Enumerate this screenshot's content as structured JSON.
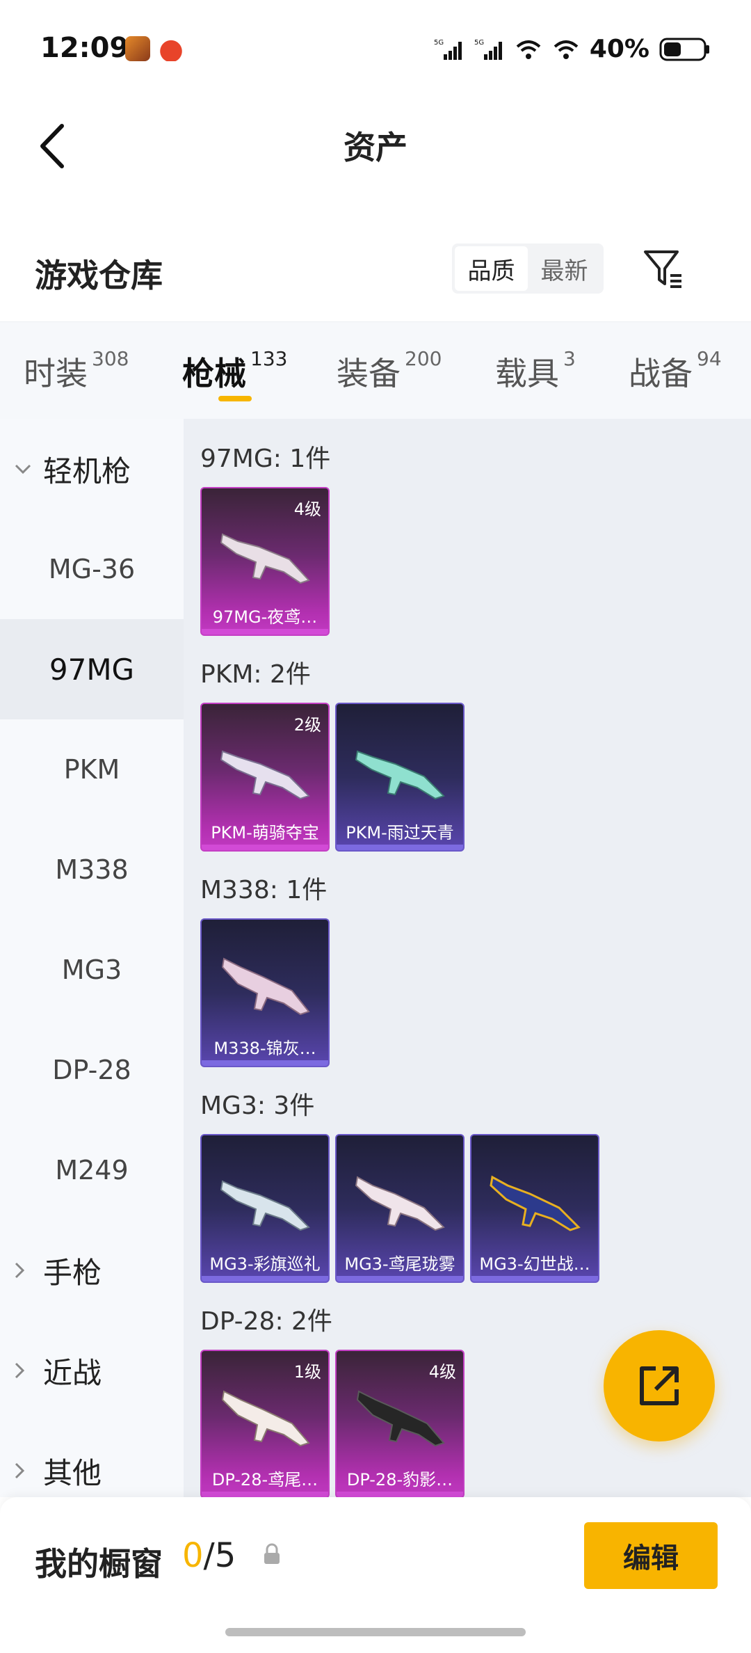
{
  "status_bar": {
    "time": "12:09",
    "battery": "40%",
    "icons": [
      "app-icon-game",
      "app-icon-mascot",
      "signal-5g-icon",
      "signal-5g-icon",
      "wifi-icon",
      "wifi-icon",
      "battery-icon"
    ]
  },
  "header": {
    "title": "资产",
    "back_icon": "chevron-left-icon"
  },
  "warehouse": {
    "title": "游戏仓库",
    "sort_options": [
      "品质",
      "最新"
    ],
    "sort_selected": "品质",
    "filter_icon": "filter-icon"
  },
  "tabs": [
    {
      "label": "时装",
      "count": "308"
    },
    {
      "label": "枪械",
      "count": "133"
    },
    {
      "label": "装备",
      "count": "200"
    },
    {
      "label": "载具",
      "count": "3"
    },
    {
      "label": "战备",
      "count": "94"
    }
  ],
  "active_tab": "枪械",
  "sidebar": {
    "group_open": "轻机枪",
    "items": [
      "MG-36",
      "97MG",
      "PKM",
      "M338",
      "MG3",
      "DP-28",
      "M249"
    ],
    "selected": "97MG",
    "groups_closed": [
      "手枪",
      "近战",
      "其他"
    ]
  },
  "content": {
    "groups": [
      {
        "title": "97MG: 1件",
        "items": [
          {
            "name": "97MG-夜鸢…",
            "level": "4级",
            "rarity": "pink"
          }
        ]
      },
      {
        "title": "PKM: 2件",
        "items": [
          {
            "name": "PKM-萌骑夺宝",
            "level": "2级",
            "rarity": "pink"
          },
          {
            "name": "PKM-雨过天青",
            "level": "",
            "rarity": "blue"
          }
        ]
      },
      {
        "title": "M338: 1件",
        "items": [
          {
            "name": "M338-锦灰…",
            "level": "",
            "rarity": "blue"
          }
        ]
      },
      {
        "title": "MG3: 3件",
        "items": [
          {
            "name": "MG3-彩旗巡礼",
            "level": "",
            "rarity": "blue"
          },
          {
            "name": "MG3-鸢尾珑雾",
            "level": "",
            "rarity": "blue"
          },
          {
            "name": "MG3-幻世战…",
            "level": "",
            "rarity": "blue"
          }
        ]
      },
      {
        "title": "DP-28: 2件",
        "items": [
          {
            "name": "DP-28-鸢尾…",
            "level": "1级",
            "rarity": "pink"
          },
          {
            "name": "DP-28-豹影…",
            "level": "4级",
            "rarity": "pink"
          }
        ]
      }
    ],
    "fab_icon": "share-external-icon"
  },
  "bottom": {
    "label": "我的橱窗",
    "current": "0",
    "total": "/5",
    "lock_icon": "lock-icon",
    "edit_label": "编辑"
  },
  "colors": {
    "accent": "#f8b400",
    "pink_rarity": "#c43fc4",
    "blue_rarity": "#6a58c8"
  }
}
